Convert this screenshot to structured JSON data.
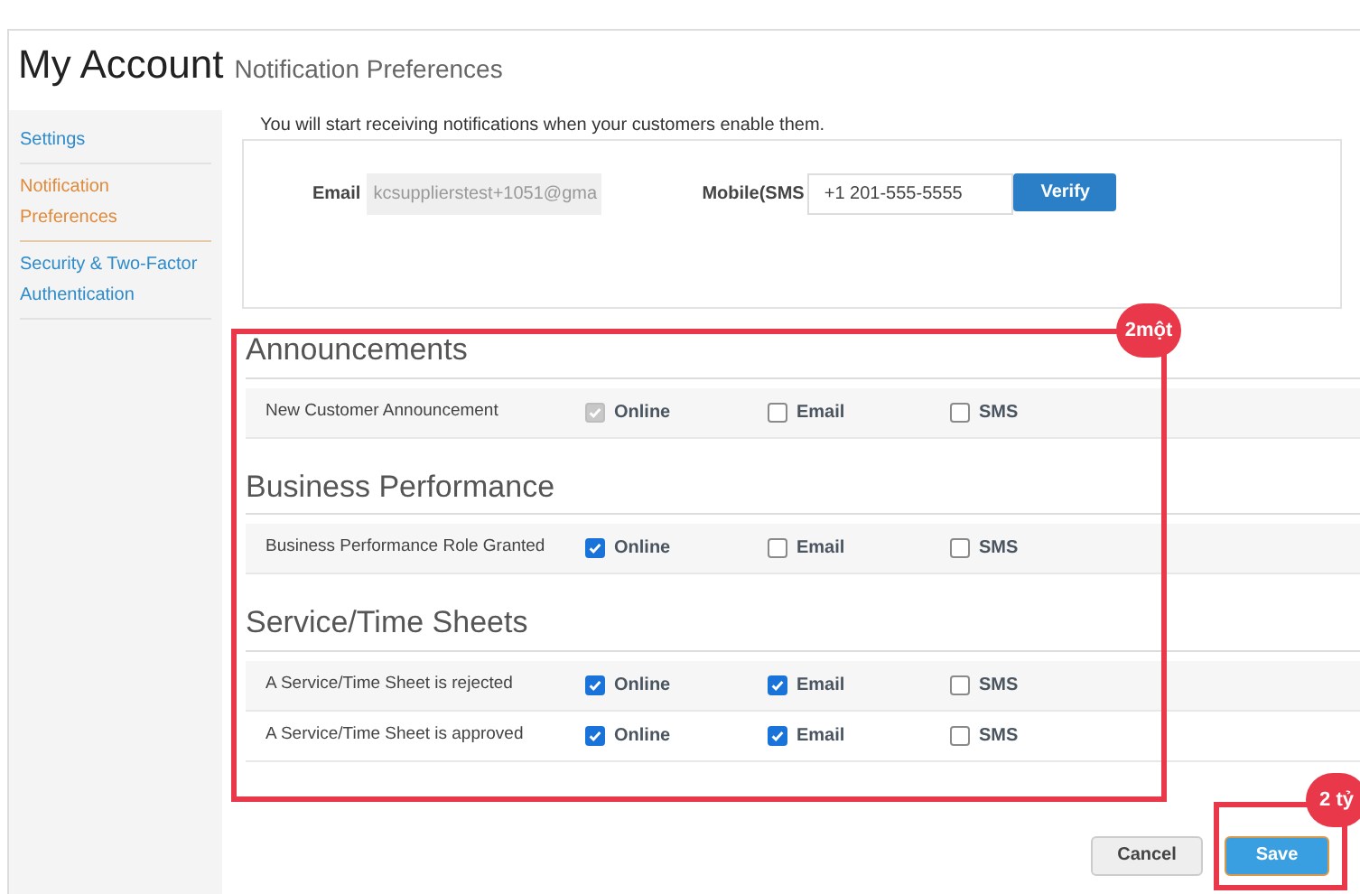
{
  "header": {
    "title": "My Account",
    "subtitle": "Notification Preferences"
  },
  "sidebar": {
    "items": [
      {
        "label": "Settings",
        "selected": false
      },
      {
        "label": "Notification Preferences",
        "selected": true
      },
      {
        "label": "Security & Two-Factor Authentication",
        "selected": false
      }
    ]
  },
  "intro": "You will start receiving notifications when your customers enable them.",
  "contact": {
    "email_label": "Email",
    "email_value": "kcsupplierstest+1051@gma",
    "mobile_label": "Mobile(SMS",
    "mobile_value": "+1 201-555-5555",
    "verify": "Verify"
  },
  "sections": [
    {
      "title": "Announcements",
      "rows": [
        {
          "label": "New Customer Announcement",
          "options": [
            {
              "label": "Online",
              "checked": true,
              "disabled": true
            },
            {
              "label": "Email",
              "checked": false,
              "disabled": false
            },
            {
              "label": "SMS",
              "checked": false,
              "disabled": false
            }
          ]
        }
      ]
    },
    {
      "title": "Business Performance",
      "rows": [
        {
          "label": "Business Performance Role Granted",
          "options": [
            {
              "label": "Online",
              "checked": true,
              "disabled": false
            },
            {
              "label": "Email",
              "checked": false,
              "disabled": false
            },
            {
              "label": "SMS",
              "checked": false,
              "disabled": false
            }
          ]
        }
      ]
    },
    {
      "title": "Service/Time Sheets",
      "rows": [
        {
          "label": "A Service/Time Sheet is rejected",
          "options": [
            {
              "label": "Online",
              "checked": true,
              "disabled": false
            },
            {
              "label": "Email",
              "checked": true,
              "disabled": false
            },
            {
              "label": "SMS",
              "checked": false,
              "disabled": false
            }
          ]
        },
        {
          "label": "A Service/Time Sheet is approved",
          "options": [
            {
              "label": "Online",
              "checked": true,
              "disabled": false
            },
            {
              "label": "Email",
              "checked": true,
              "disabled": false
            },
            {
              "label": "SMS",
              "checked": false,
              "disabled": false
            }
          ]
        }
      ]
    }
  ],
  "buttons": {
    "cancel": "Cancel",
    "save": "Save"
  },
  "annotations": [
    {
      "badge": "2một"
    },
    {
      "badge": "2 tỷ"
    }
  ]
}
